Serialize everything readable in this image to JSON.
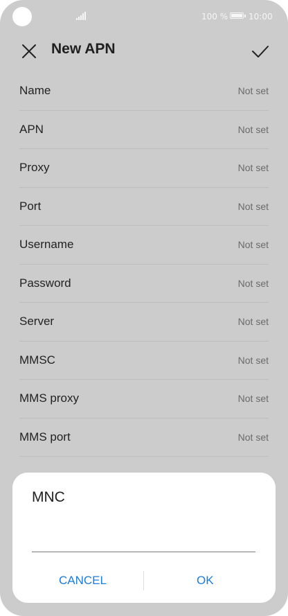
{
  "status_bar": {
    "battery_percent": "100 %",
    "time": "10:00"
  },
  "header": {
    "title": "New APN",
    "close_icon": "close-icon",
    "confirm_icon": "check-icon"
  },
  "settings": {
    "items": [
      {
        "label": "Name",
        "value": "Not set"
      },
      {
        "label": "APN",
        "value": "Not set"
      },
      {
        "label": "Proxy",
        "value": "Not set"
      },
      {
        "label": "Port",
        "value": "Not set"
      },
      {
        "label": "Username",
        "value": "Not set"
      },
      {
        "label": "Password",
        "value": "Not set"
      },
      {
        "label": "Server",
        "value": "Not set"
      },
      {
        "label": "MMSC",
        "value": "Not set"
      },
      {
        "label": "MMS proxy",
        "value": "Not set"
      },
      {
        "label": "MMS port",
        "value": "Not set"
      }
    ]
  },
  "dialog": {
    "title": "MNC",
    "input_value": "",
    "cancel_label": "CANCEL",
    "ok_label": "OK"
  },
  "colors": {
    "accent": "#1a7be0",
    "dim_background": "#cccccc",
    "dialog_background": "#ffffff"
  }
}
